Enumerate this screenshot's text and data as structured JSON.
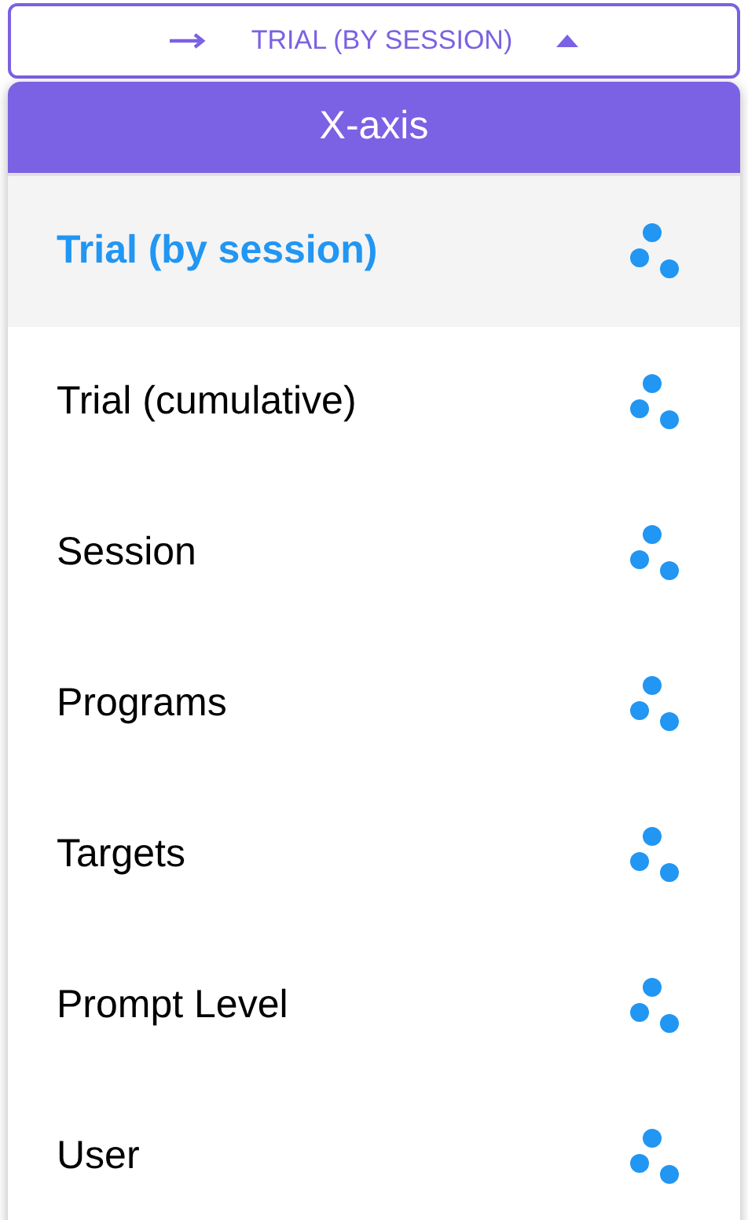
{
  "dropdown_button": {
    "label": "TRIAL (BY SESSION)",
    "expanded": true
  },
  "menu": {
    "title": "X-axis",
    "items": [
      {
        "label": "Trial (by session)",
        "selected": true
      },
      {
        "label": "Trial (cumulative)",
        "selected": false
      },
      {
        "label": "Session",
        "selected": false
      },
      {
        "label": "Programs",
        "selected": false
      },
      {
        "label": "Targets",
        "selected": false
      },
      {
        "label": "Prompt Level",
        "selected": false
      },
      {
        "label": "User",
        "selected": false
      }
    ]
  }
}
